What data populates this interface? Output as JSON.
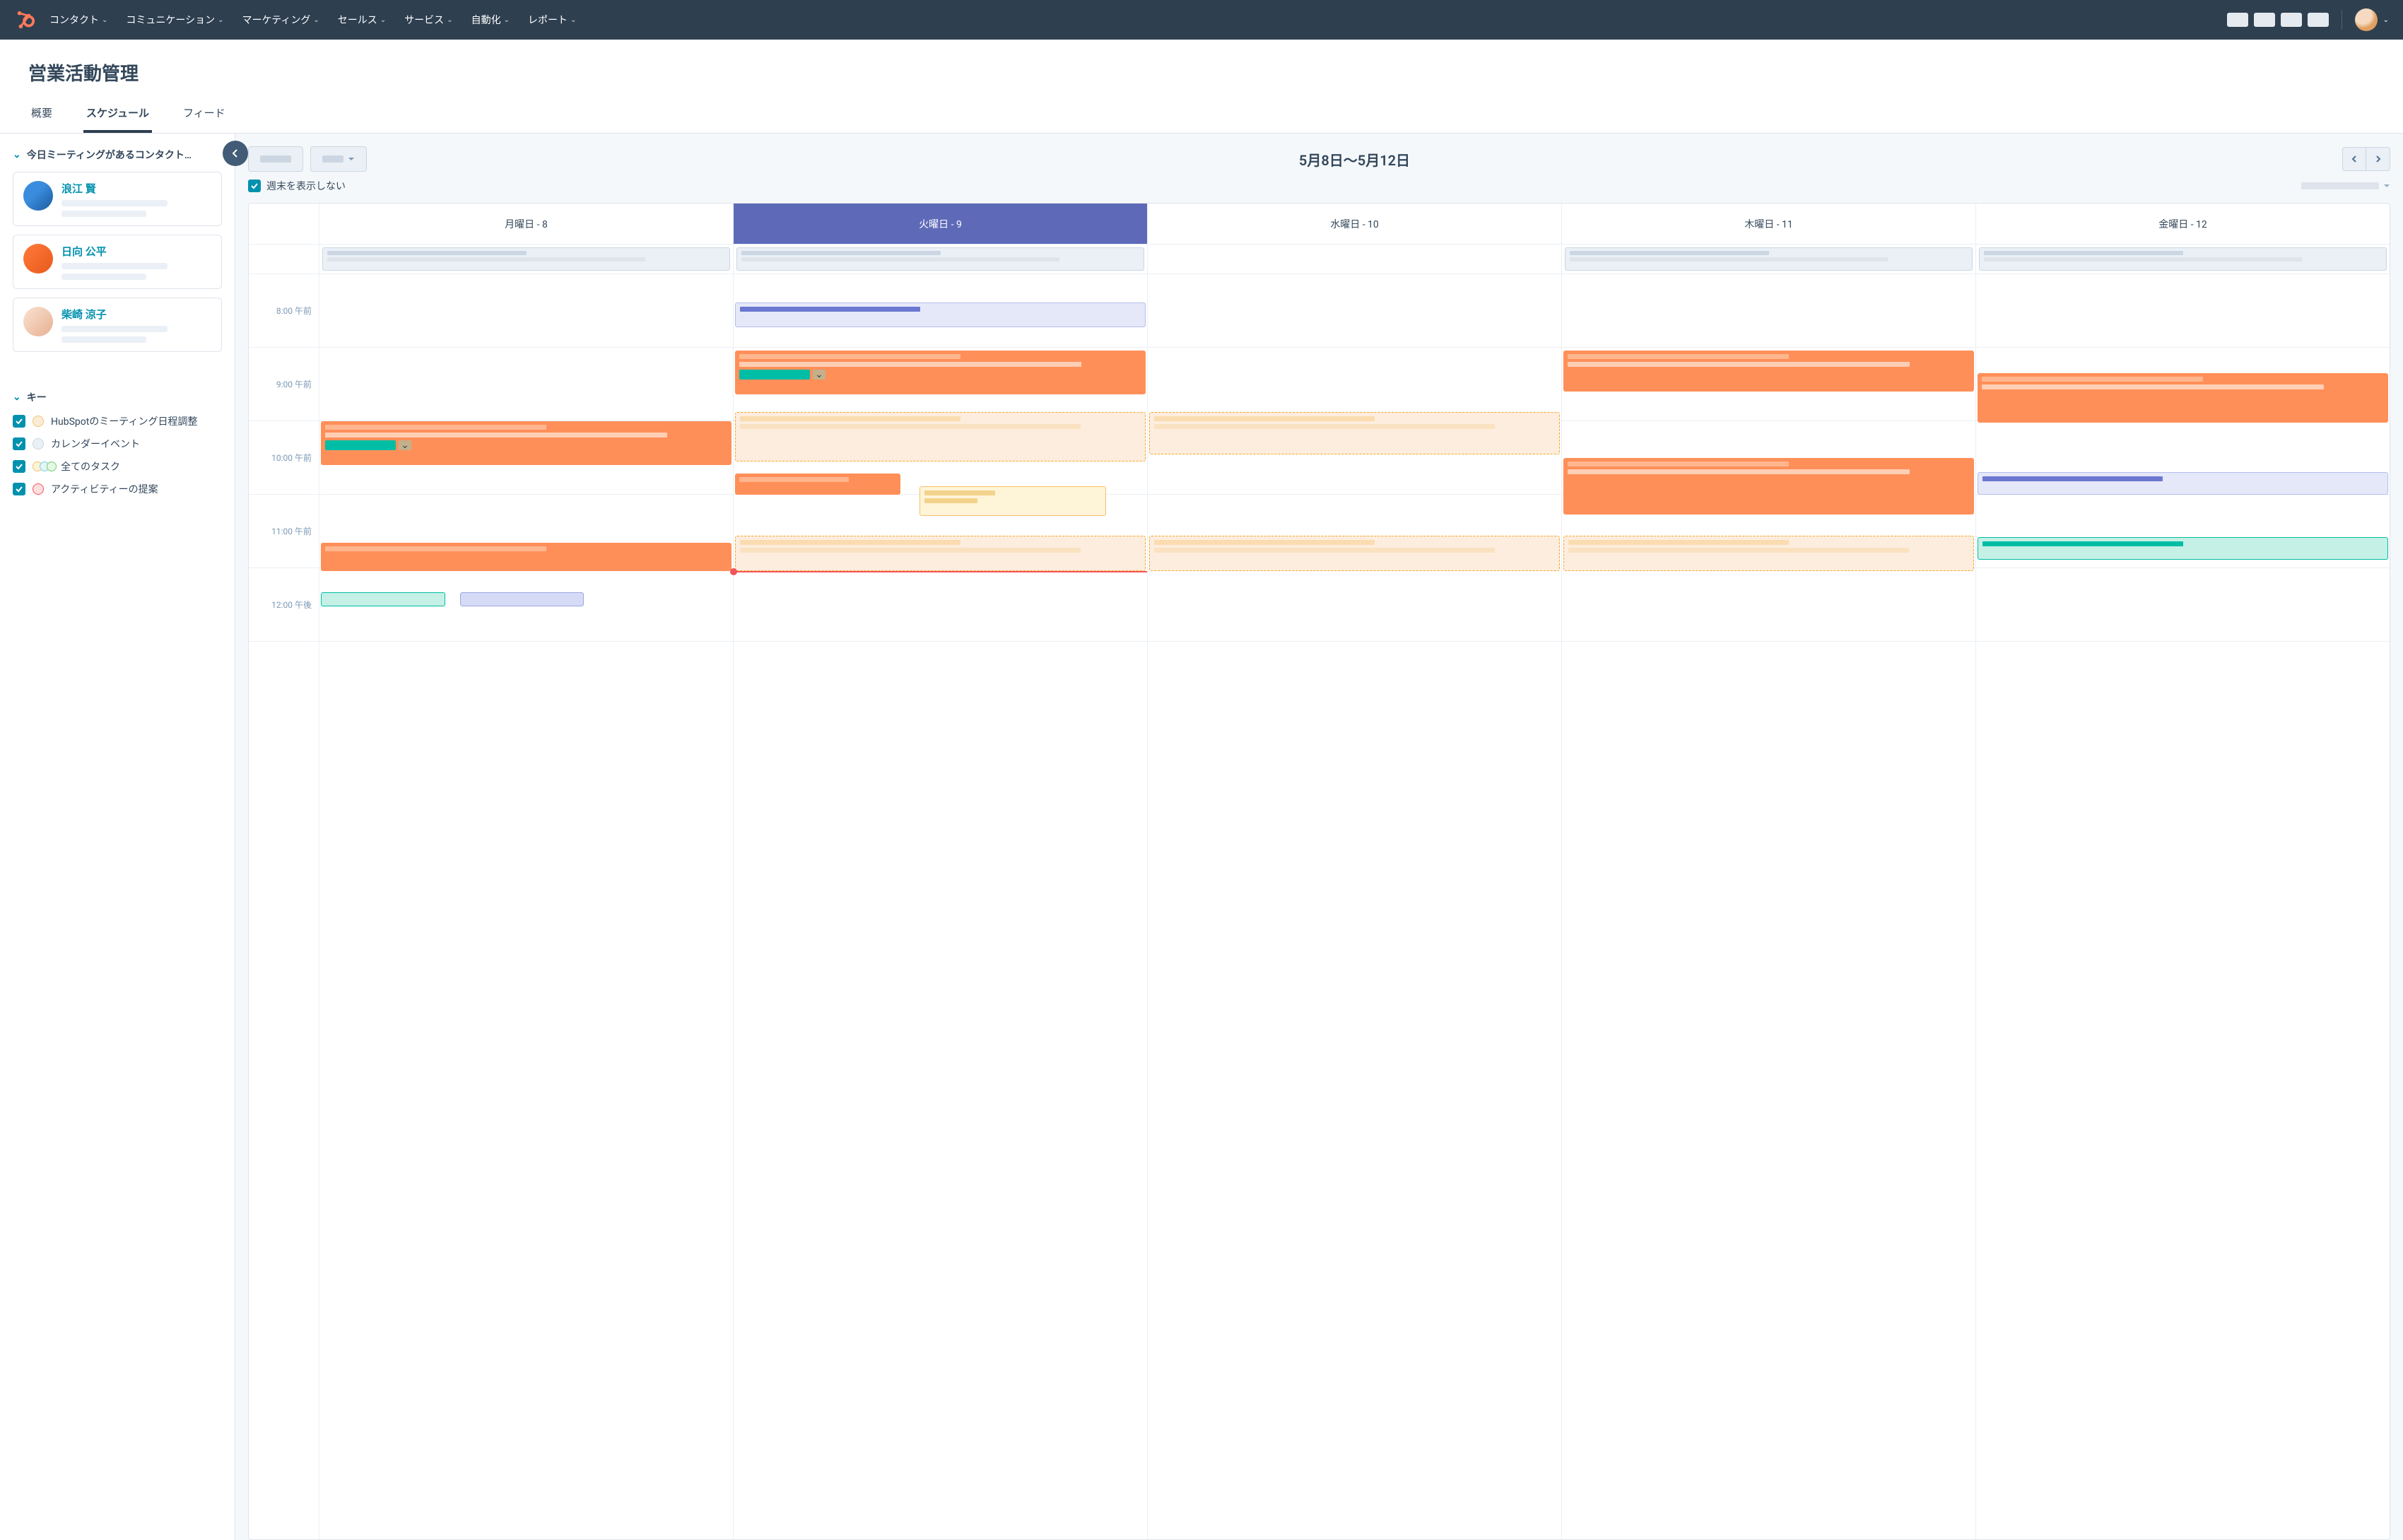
{
  "nav": {
    "items": [
      "コンタクト",
      "コミュニケーション",
      "マーケティング",
      "セールス",
      "サービス",
      "自動化",
      "レポート"
    ]
  },
  "page": {
    "title": "営業活動管理"
  },
  "tabs": [
    "概要",
    "スケジュール",
    "フィード"
  ],
  "sidebar": {
    "meetings_header": "今日ミーティングがあるコンタクト…",
    "contacts": [
      {
        "name": "浪江 賢"
      },
      {
        "name": "日向 公平"
      },
      {
        "name": "柴崎 涼子"
      }
    ],
    "key_header": "キー",
    "keys": [
      "HubSpotのミーティング日程調整",
      "カレンダーイベント",
      "全てのタスク",
      "アクティビティーの提案"
    ]
  },
  "calendar": {
    "range_title": "5月8日〜5月12日",
    "hide_weekend": "週末を表示しない",
    "days": [
      "月曜日 - 8",
      "火曜日 - 9",
      "水曜日 - 10",
      "木曜日 - 11",
      "金曜日 - 12"
    ],
    "hours": [
      "8:00 午前",
      "9:00 午前",
      "10:00 午前",
      "11:00 午前",
      "12:00 午後"
    ]
  }
}
